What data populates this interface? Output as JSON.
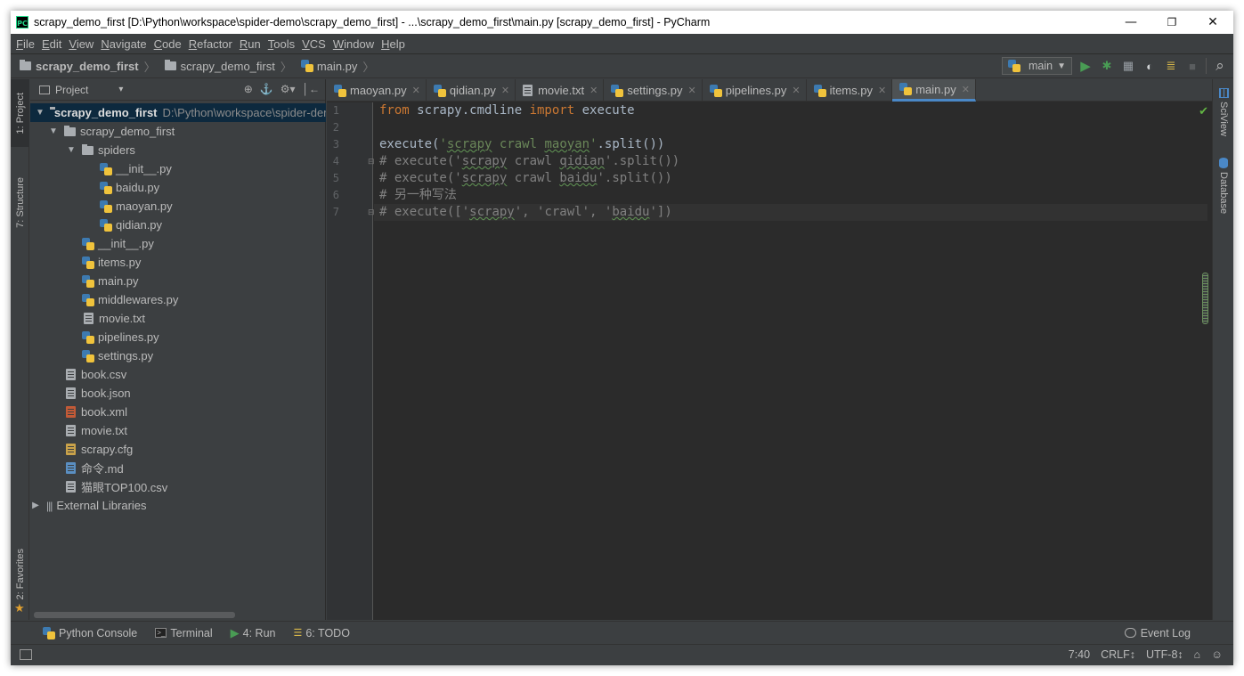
{
  "window": {
    "title": "scrapy_demo_first [D:\\Python\\workspace\\spider-demo\\scrapy_demo_first] - ...\\scrapy_demo_first\\main.py [scrapy_demo_first] - PyCharm",
    "app_icon": "PC",
    "minimize": "—",
    "restore": "❐",
    "close": "✕"
  },
  "menu": [
    "File",
    "Edit",
    "View",
    "Navigate",
    "Code",
    "Refactor",
    "Run",
    "Tools",
    "VCS",
    "Window",
    "Help"
  ],
  "breadcrumb": {
    "project": "scrapy_demo_first",
    "folder": "scrapy_demo_first",
    "file": "main.py"
  },
  "toolbar": {
    "run_config": "main",
    "run_icon": "▶",
    "debug_icon": "✱",
    "coverage_icon": "▦",
    "profile_icon": "◐",
    "concurrency_icon": "≣",
    "stop_icon": "■",
    "search_icon": "⌕"
  },
  "left_tabs": {
    "project": "1: Project",
    "structure": "7: Structure",
    "favorites": "2: Favorites"
  },
  "right_tabs": {
    "sciview": "SciView",
    "database": "Database"
  },
  "project_panel": {
    "header": "Project",
    "dropdown": "▾",
    "tools": [
      "⊕",
      "⚓",
      "⚙▾",
      "│←"
    ],
    "tree": [
      {
        "label": "scrapy_demo_first",
        "path": "D:\\Python\\workspace\\spider-demo\\scrapy_demo_first",
        "icon": "folder",
        "arrow": "▼"
      },
      {
        "label": "scrapy_demo_first",
        "icon": "folder",
        "arrow": "▼"
      },
      {
        "label": "spiders",
        "icon": "folder",
        "arrow": "▼"
      },
      {
        "label": "__init__.py",
        "icon": "python"
      },
      {
        "label": "baidu.py",
        "icon": "python"
      },
      {
        "label": "maoyan.py",
        "icon": "python"
      },
      {
        "label": "qidian.py",
        "icon": "python"
      },
      {
        "label": "__init__.py",
        "icon": "python"
      },
      {
        "label": "items.py",
        "icon": "python"
      },
      {
        "label": "main.py",
        "icon": "python"
      },
      {
        "label": "middlewares.py",
        "icon": "python"
      },
      {
        "label": "movie.txt",
        "icon": "text"
      },
      {
        "label": "pipelines.py",
        "icon": "python"
      },
      {
        "label": "settings.py",
        "icon": "python"
      },
      {
        "label": "book.csv",
        "icon": "text"
      },
      {
        "label": "book.json",
        "icon": "text"
      },
      {
        "label": "book.xml",
        "icon": "xml"
      },
      {
        "label": "movie.txt",
        "icon": "text"
      },
      {
        "label": "scrapy.cfg",
        "icon": "config"
      },
      {
        "label": "命令.md",
        "icon": "markdown"
      },
      {
        "label": "猫眼TOP100.csv",
        "icon": "text"
      },
      {
        "label": "External Libraries",
        "icon": "library",
        "arrow": "▶"
      }
    ]
  },
  "editor": {
    "tabs": [
      {
        "label": "maoyan.py",
        "icon": "python"
      },
      {
        "label": "qidian.py",
        "icon": "python"
      },
      {
        "label": "movie.txt",
        "icon": "text"
      },
      {
        "label": "settings.py",
        "icon": "python"
      },
      {
        "label": "pipelines.py",
        "icon": "python"
      },
      {
        "label": "items.py",
        "icon": "python"
      },
      {
        "label": "main.py",
        "icon": "python",
        "active": true
      }
    ],
    "close_glyph": "✕",
    "line_numbers": [
      "1",
      "2",
      "3",
      "4",
      "5",
      "6",
      "7"
    ],
    "code": {
      "l1_kw1": "from",
      "l1_mid": " scrapy.cmdline ",
      "l1_kw2": "import",
      "l1_end": " execute",
      "l3_a": "execute(",
      "l3_q1": "'",
      "l3_s1": "scrapy",
      "l3_sp1": " ",
      "l3_s2": "crawl",
      "l3_sp2": " ",
      "l3_s3": "maoyan",
      "l3_q2": "'",
      "l3_b": ".split())",
      "l4_a": "# execute('",
      "l4_s1": "scrapy",
      "l4_b": " crawl ",
      "l4_s2": "qidian",
      "l4_c": "'.split())",
      "l5_a": "# execute('",
      "l5_s1": "scrapy",
      "l5_b": " crawl ",
      "l5_s2": "baidu",
      "l5_c": "'.split())",
      "l6": "# 另一种写法",
      "l7_a": "# execute(['",
      "l7_s1": "scrapy",
      "l7_b": "', 'crawl', '",
      "l7_s2": "baidu",
      "l7_c": "'])"
    },
    "check_icon": "✔"
  },
  "bottom_tools": [
    {
      "label": "Python Console",
      "icon": "python"
    },
    {
      "label": "Terminal",
      "icon": ">_"
    },
    {
      "label": "4: Run",
      "icon": "▶"
    },
    {
      "label": "6: TODO",
      "icon": "☰"
    }
  ],
  "event_log": "Event Log",
  "status": {
    "position": "7:40",
    "line_separator": "CRLF↕",
    "encoding": "UTF-8↕",
    "lock_icon": "⌂",
    "inspector_icon": "☺"
  }
}
